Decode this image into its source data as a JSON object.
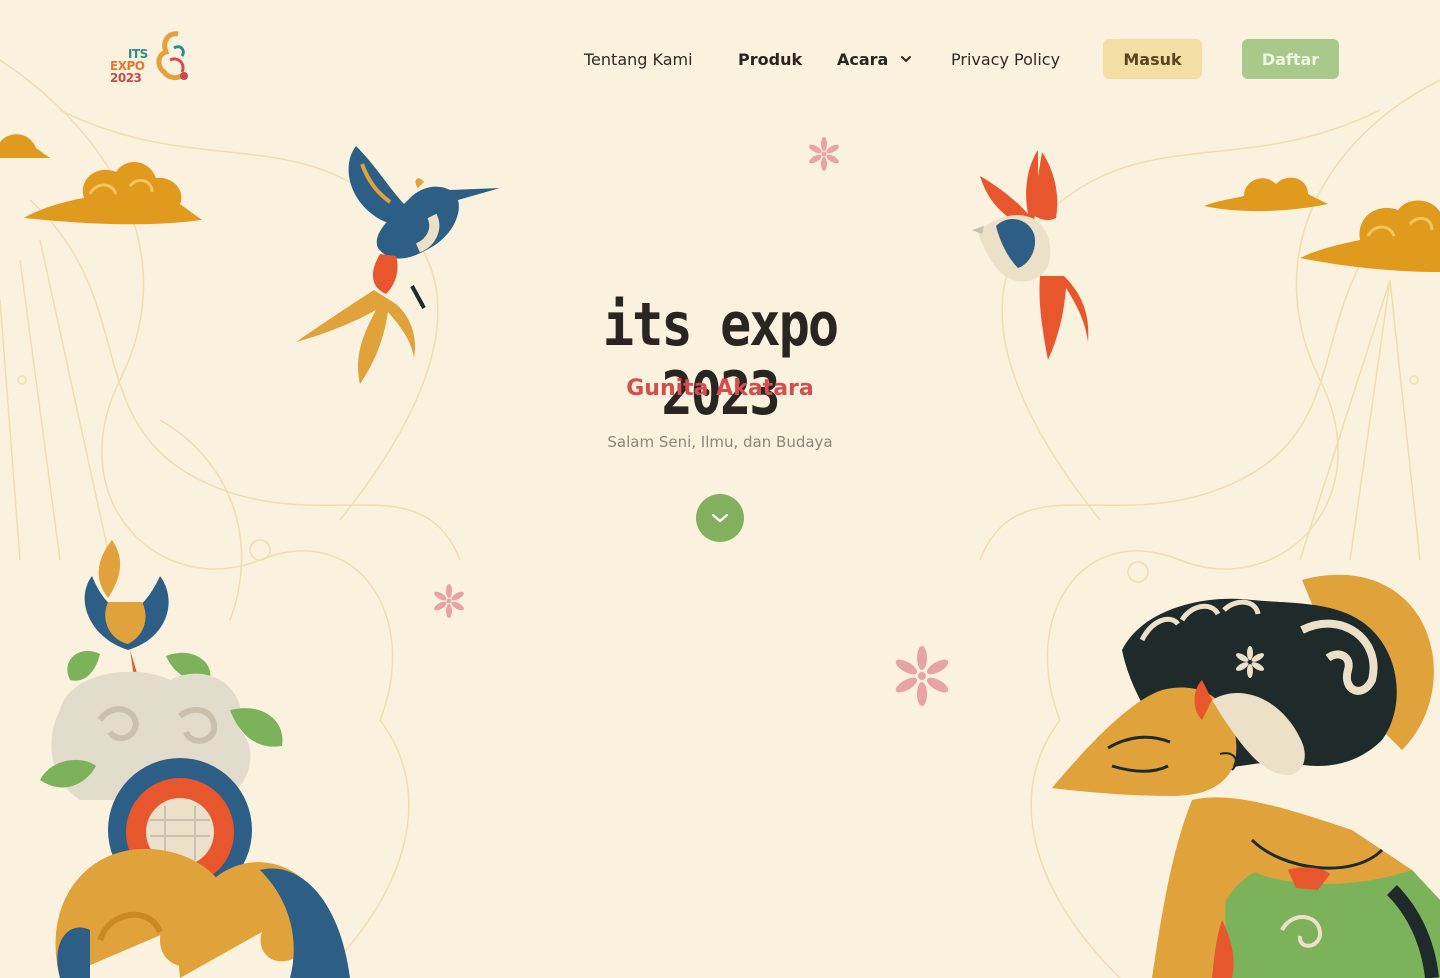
{
  "brand": {
    "logo_lines": [
      "ITS",
      "EXPO",
      "2023"
    ]
  },
  "nav": {
    "items": [
      {
        "label": "Tentang Kami"
      },
      {
        "label": "Produk"
      },
      {
        "label": "Acara"
      },
      {
        "label": "Privacy Policy"
      }
    ],
    "login_label": "Masuk",
    "register_label": "Daftar"
  },
  "hero": {
    "title": "its expo 2023",
    "subtitle": "Gunita Akatara",
    "tagline": "Salam Seni, Ilmu, dan Budaya",
    "scroll_icon": "chevron-down-icon"
  },
  "colors": {
    "background": "#faf2df",
    "accent_red": "#d64d4d",
    "accent_green": "#82b05e",
    "login_button": "#f3dfa3",
    "register_button": "#a9c98a",
    "cloud": "#e09a1e"
  }
}
